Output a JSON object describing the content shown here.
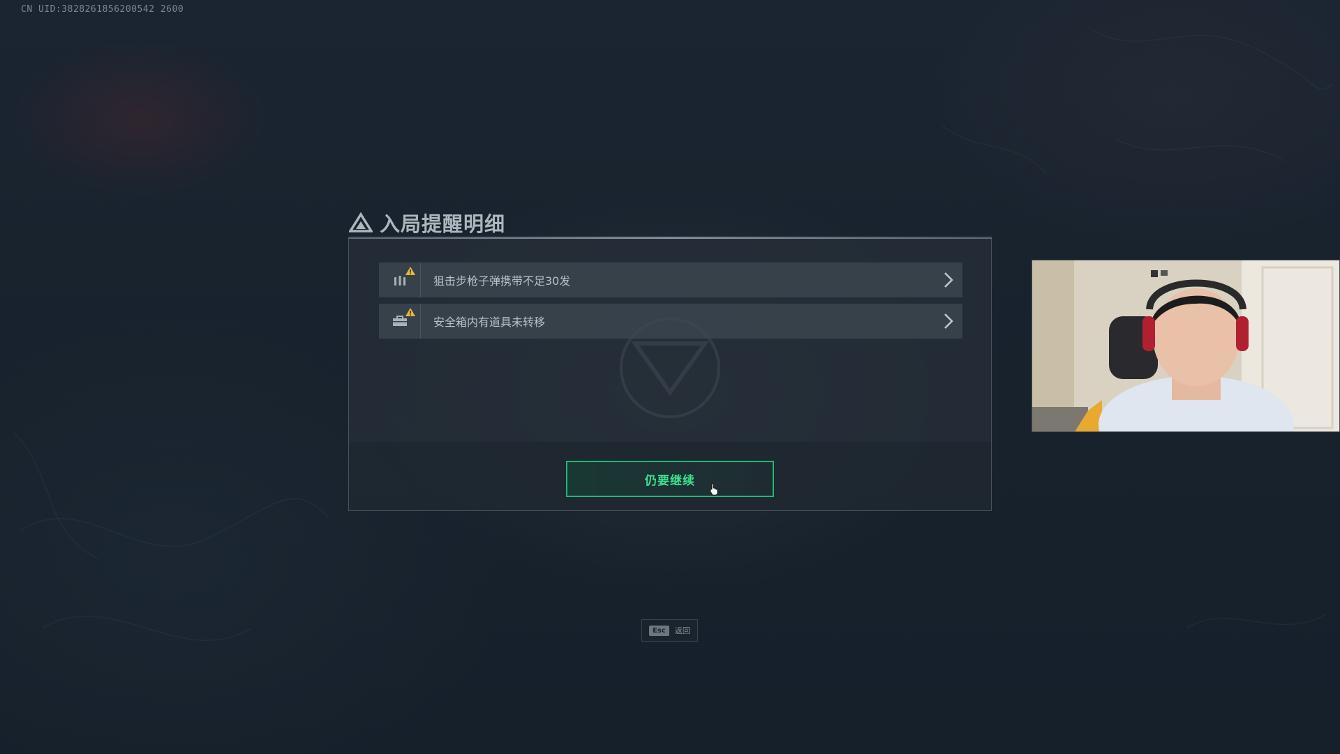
{
  "hud": {
    "uid_text": "CN UID:3828261856200542 2600"
  },
  "dialog": {
    "title": "入局提醒明细",
    "alerts": [
      {
        "icon": "ammo-icon",
        "label": "狙击步枪子弹携带不足30发"
      },
      {
        "icon": "safe-box-icon",
        "label": "安全箱内有道具未转移"
      }
    ],
    "continue_label": "仍要继续"
  },
  "footer": {
    "esc_key": "Esc",
    "esc_label": "返回"
  },
  "colors": {
    "accent_green": "#1fb873",
    "warning_yellow": "#e8b73a"
  }
}
